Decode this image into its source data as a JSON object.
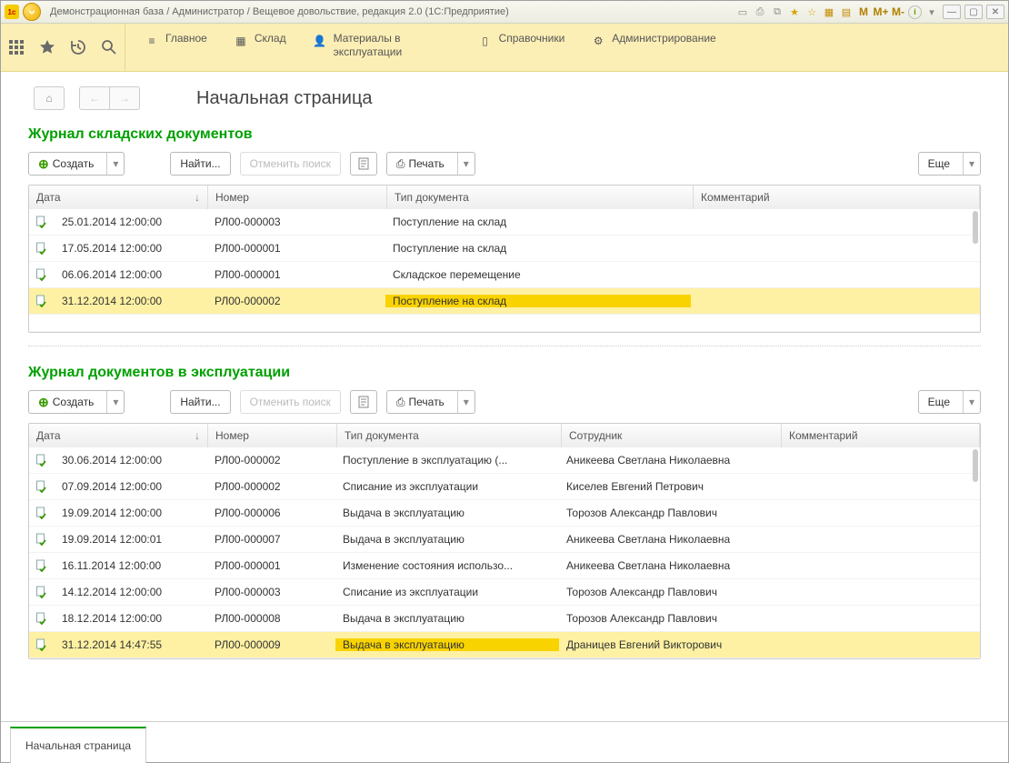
{
  "title": "Демонстрационная база / Администратор / Вещевое довольствие, редакция 2.0  (1С:Предприятие)",
  "titlebarIcons": {
    "m": "M",
    "mp": "M+",
    "mm": "M-"
  },
  "menu": {
    "main": "Главное",
    "sklad": "Склад",
    "materials": "Материалы в эксплуатации",
    "refs": "Справочники",
    "admin": "Администрирование"
  },
  "pageTitle": "Начальная страница",
  "buttons": {
    "create": "Создать",
    "find": "Найти...",
    "cancelFind": "Отменить поиск",
    "print": "Печать",
    "more": "Еще"
  },
  "section1": {
    "title": "Журнал складских документов",
    "headers": {
      "date": "Дата",
      "num": "Номер",
      "type": "Тип документа",
      "comment": "Комментарий"
    },
    "rows": [
      {
        "date": "25.01.2014 12:00:00",
        "num": "РЛ00-000003",
        "type": "Поступление на склад",
        "comment": ""
      },
      {
        "date": "17.05.2014 12:00:00",
        "num": "РЛ00-000001",
        "type": "Поступление на склад",
        "comment": ""
      },
      {
        "date": "06.06.2014 12:00:00",
        "num": "РЛ00-000001",
        "type": "Складское перемещение",
        "comment": ""
      },
      {
        "date": "31.12.2014 12:00:00",
        "num": "РЛ00-000002",
        "type": "Поступление на склад",
        "comment": ""
      }
    ],
    "selected": 3
  },
  "section2": {
    "title": "Журнал документов в эксплуатации",
    "headers": {
      "date": "Дата",
      "num": "Номер",
      "type": "Тип документа",
      "emp": "Сотрудник",
      "comment": "Комментарий"
    },
    "rows": [
      {
        "date": "30.06.2014 12:00:00",
        "num": "РЛ00-000002",
        "type": "Поступление в эксплуатацию (...",
        "emp": "Аникеева Светлана Николаевна",
        "comment": ""
      },
      {
        "date": "07.09.2014 12:00:00",
        "num": "РЛ00-000002",
        "type": "Списание из эксплуатации",
        "emp": "Киселев Евгений Петрович",
        "comment": ""
      },
      {
        "date": "19.09.2014 12:00:00",
        "num": "РЛ00-000006",
        "type": "Выдача в эксплуатацию",
        "emp": "Торозов Александр Павлович",
        "comment": ""
      },
      {
        "date": "19.09.2014 12:00:01",
        "num": "РЛ00-000007",
        "type": "Выдача в эксплуатацию",
        "emp": "Аникеева Светлана Николаевна",
        "comment": ""
      },
      {
        "date": "16.11.2014 12:00:00",
        "num": "РЛ00-000001",
        "type": "Изменение состояния использо...",
        "emp": "Аникеева Светлана Николаевна",
        "comment": ""
      },
      {
        "date": "14.12.2014 12:00:00",
        "num": "РЛ00-000003",
        "type": "Списание из эксплуатации",
        "emp": "Торозов Александр Павлович",
        "comment": ""
      },
      {
        "date": "18.12.2014 12:00:00",
        "num": "РЛ00-000008",
        "type": "Выдача в эксплуатацию",
        "emp": "Торозов Александр Павлович",
        "comment": ""
      },
      {
        "date": "31.12.2014 14:47:55",
        "num": "РЛ00-000009",
        "type": "Выдача в эксплуатацию",
        "emp": "Драницев Евгений Викторович",
        "comment": ""
      }
    ],
    "selected": 7
  },
  "tab": "Начальная страница"
}
